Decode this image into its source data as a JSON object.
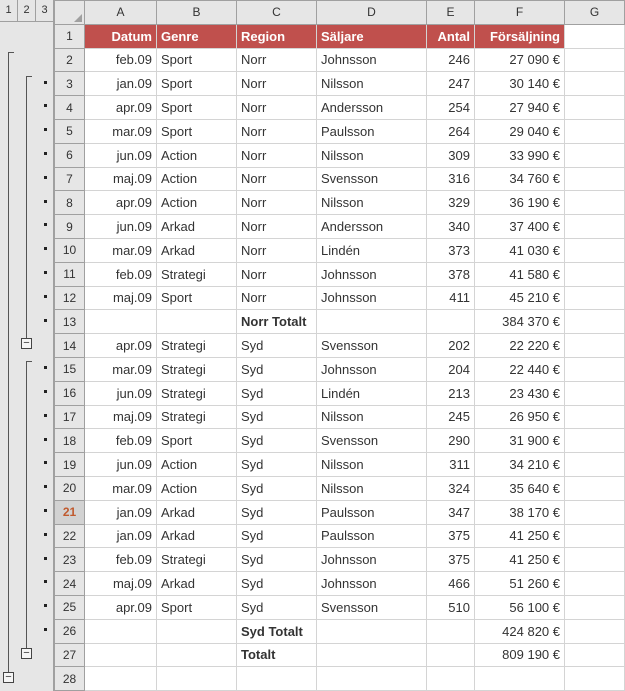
{
  "outline_levels": [
    "1",
    "2",
    "3"
  ],
  "columns": [
    "A",
    "B",
    "C",
    "D",
    "E",
    "F",
    "G"
  ],
  "headers": {
    "A": "Datum",
    "B": "Genre",
    "C": "Region",
    "D": "Säljare",
    "E": "Antal",
    "F": "Försäljning"
  },
  "rows": [
    {
      "n": 1,
      "type": "header"
    },
    {
      "n": 2,
      "A": "feb.09",
      "B": "Sport",
      "C": "Norr",
      "D": "Johnsson",
      "E": "246",
      "F": "27 090 €"
    },
    {
      "n": 3,
      "A": "jan.09",
      "B": "Sport",
      "C": "Norr",
      "D": "Nilsson",
      "E": "247",
      "F": "30 140 €"
    },
    {
      "n": 4,
      "A": "apr.09",
      "B": "Sport",
      "C": "Norr",
      "D": "Andersson",
      "E": "254",
      "F": "27 940 €"
    },
    {
      "n": 5,
      "A": "mar.09",
      "B": "Sport",
      "C": "Norr",
      "D": "Paulsson",
      "E": "264",
      "F": "29 040 €"
    },
    {
      "n": 6,
      "A": "jun.09",
      "B": "Action",
      "C": "Norr",
      "D": "Nilsson",
      "E": "309",
      "F": "33 990 €"
    },
    {
      "n": 7,
      "A": "maj.09",
      "B": "Action",
      "C": "Norr",
      "D": "Svensson",
      "E": "316",
      "F": "34 760 €"
    },
    {
      "n": 8,
      "A": "apr.09",
      "B": "Action",
      "C": "Norr",
      "D": "Nilsson",
      "E": "329",
      "F": "36 190 €"
    },
    {
      "n": 9,
      "A": "jun.09",
      "B": "Arkad",
      "C": "Norr",
      "D": "Andersson",
      "E": "340",
      "F": "37 400 €"
    },
    {
      "n": 10,
      "A": "mar.09",
      "B": "Arkad",
      "C": "Norr",
      "D": "Lindén",
      "E": "373",
      "F": "41 030 €"
    },
    {
      "n": 11,
      "A": "feb.09",
      "B": "Strategi",
      "C": "Norr",
      "D": "Johnsson",
      "E": "378",
      "F": "41 580 €"
    },
    {
      "n": 12,
      "A": "maj.09",
      "B": "Sport",
      "C": "Norr",
      "D": "Johnsson",
      "E": "411",
      "F": "45 210 €"
    },
    {
      "n": 13,
      "type": "subtotal",
      "C": "Norr Totalt",
      "F": "384 370 €"
    },
    {
      "n": 14,
      "A": "apr.09",
      "B": "Strategi",
      "C": "Syd",
      "D": "Svensson",
      "E": "202",
      "F": "22 220 €"
    },
    {
      "n": 15,
      "A": "mar.09",
      "B": "Strategi",
      "C": "Syd",
      "D": "Johnsson",
      "E": "204",
      "F": "22 440 €"
    },
    {
      "n": 16,
      "A": "jun.09",
      "B": "Strategi",
      "C": "Syd",
      "D": "Lindén",
      "E": "213",
      "F": "23 430 €"
    },
    {
      "n": 17,
      "A": "maj.09",
      "B": "Strategi",
      "C": "Syd",
      "D": "Nilsson",
      "E": "245",
      "F": "26 950 €"
    },
    {
      "n": 18,
      "A": "feb.09",
      "B": "Sport",
      "C": "Syd",
      "D": "Svensson",
      "E": "290",
      "F": "31 900 €"
    },
    {
      "n": 19,
      "A": "jun.09",
      "B": "Action",
      "C": "Syd",
      "D": "Nilsson",
      "E": "311",
      "F": "34 210 €"
    },
    {
      "n": 20,
      "A": "mar.09",
      "B": "Action",
      "C": "Syd",
      "D": "Nilsson",
      "E": "324",
      "F": "35 640 €"
    },
    {
      "n": 21,
      "A": "jan.09",
      "B": "Arkad",
      "C": "Syd",
      "D": "Paulsson",
      "E": "347",
      "F": "38 170 €",
      "active": true
    },
    {
      "n": 22,
      "A": "jan.09",
      "B": "Arkad",
      "C": "Syd",
      "D": "Paulsson",
      "E": "375",
      "F": "41 250 €"
    },
    {
      "n": 23,
      "A": "feb.09",
      "B": "Strategi",
      "C": "Syd",
      "D": "Johnsson",
      "E": "375",
      "F": "41 250 €"
    },
    {
      "n": 24,
      "A": "maj.09",
      "B": "Arkad",
      "C": "Syd",
      "D": "Johnsson",
      "E": "466",
      "F": "51 260 €"
    },
    {
      "n": 25,
      "A": "apr.09",
      "B": "Sport",
      "C": "Syd",
      "D": "Svensson",
      "E": "510",
      "F": "56 100 €"
    },
    {
      "n": 26,
      "type": "subtotal",
      "C": "Syd Totalt",
      "F": "424 820 €"
    },
    {
      "n": 27,
      "type": "grand",
      "C": "Totalt",
      "F": "809 190 €"
    },
    {
      "n": 28
    }
  ]
}
